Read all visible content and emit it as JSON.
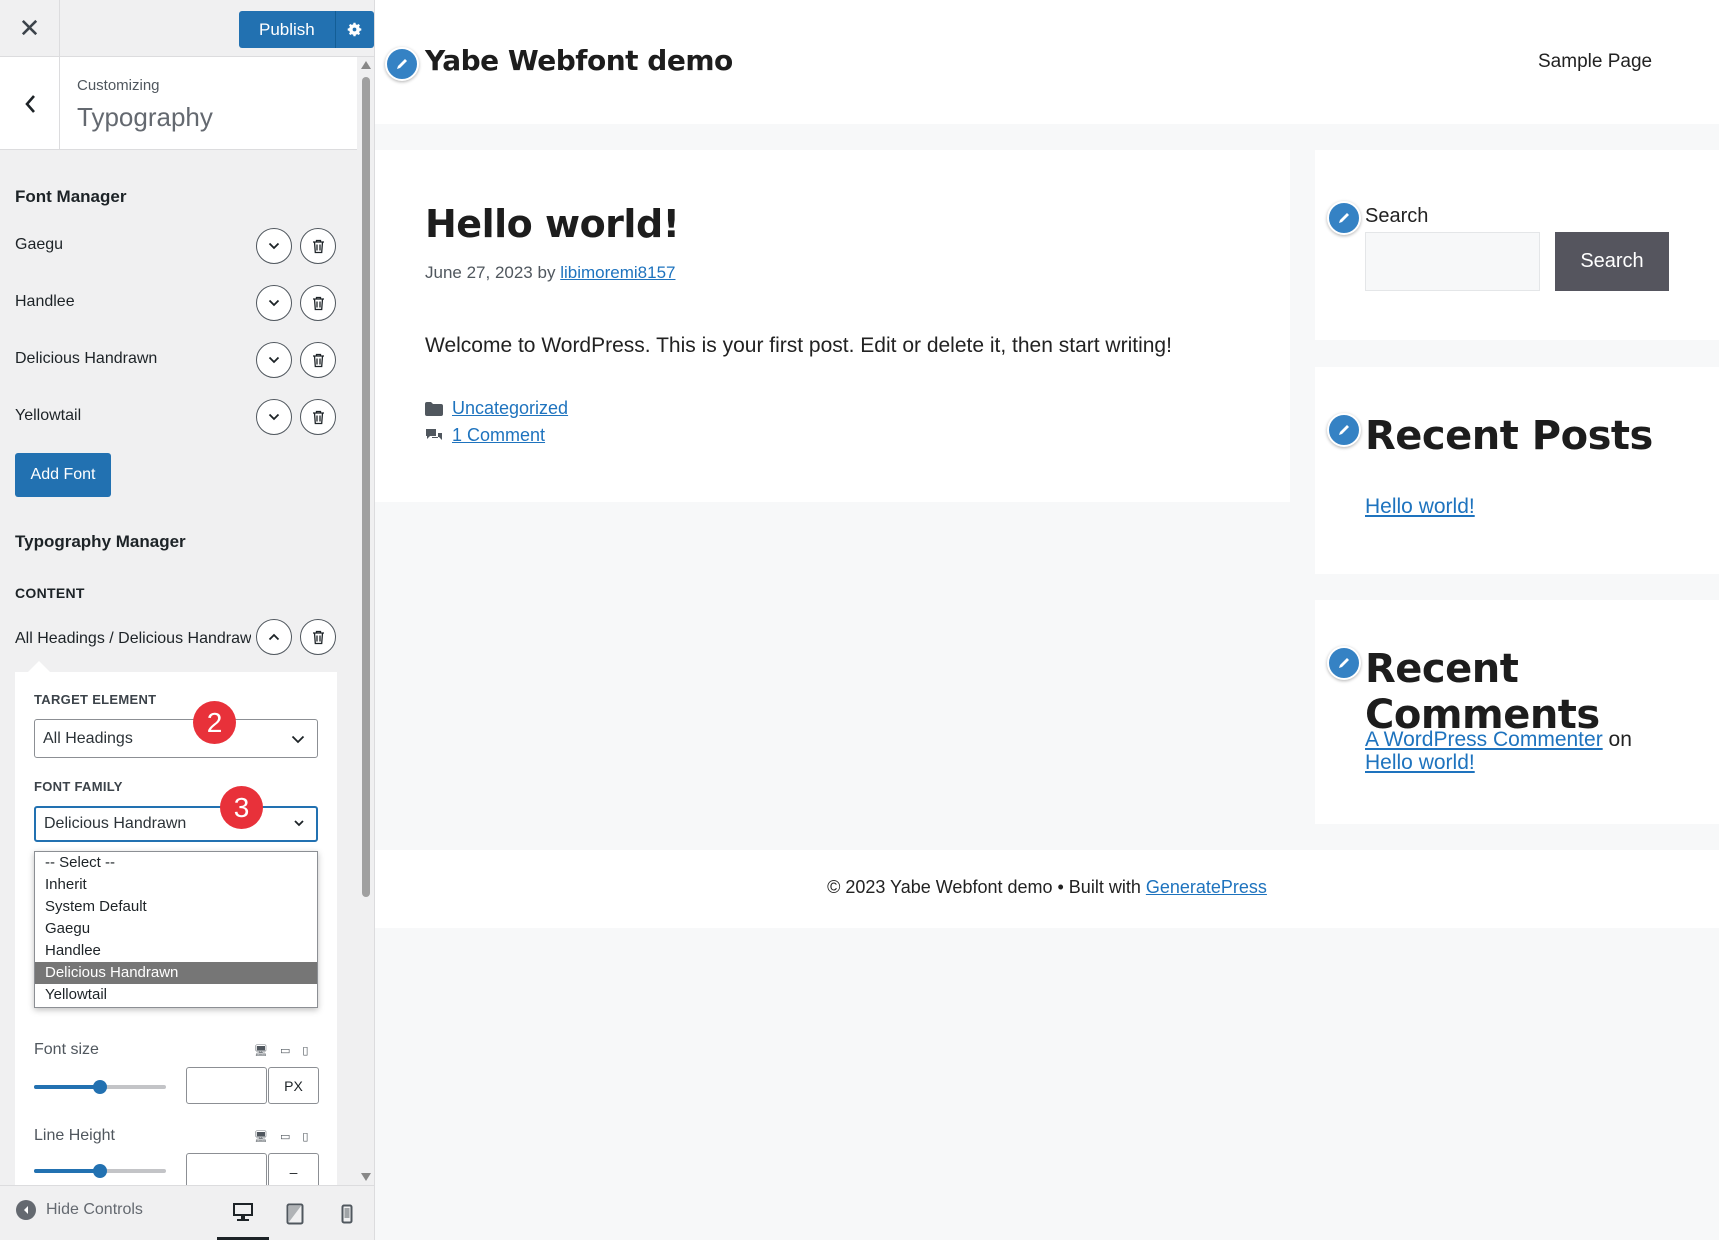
{
  "topbar": {
    "close_glyph": "✕",
    "publish_label": "Publish",
    "settings_icon": "gear-icon"
  },
  "section": {
    "customizing_label": "Customizing",
    "title": "Typography"
  },
  "font_manager": {
    "heading": "Font Manager",
    "fonts": [
      {
        "name": "Gaegu"
      },
      {
        "name": "Handlee"
      },
      {
        "name": "Delicious Handrawn"
      },
      {
        "name": "Yellowtail"
      }
    ],
    "add_font_label": "Add Font"
  },
  "typography_manager": {
    "heading": "Typography Manager",
    "content_label": "CONTENT",
    "row_label": "All Headings / Delicious Handrawn",
    "target_element": {
      "label": "TARGET ELEMENT",
      "value": "All Headings"
    },
    "font_family": {
      "label": "FONT FAMILY",
      "value": "Delicious Handrawn",
      "options": [
        "-- Select --",
        "Inherit",
        "System Default",
        "Gaegu",
        "Handlee",
        "Delicious Handrawn",
        "Yellowtail"
      ],
      "selected_index": 5
    },
    "font_size": {
      "label": "Font size",
      "unit": "PX",
      "slider_fraction": 0.5
    },
    "line_height": {
      "label": "Line Height",
      "unit": "–",
      "slider_fraction": 0.5
    }
  },
  "badges": {
    "step2": "2",
    "step3": "3"
  },
  "footer_bar": {
    "hide_controls": "Hide Controls"
  },
  "preview": {
    "site_title": "Yabe Webfont demo",
    "nav": {
      "sample_page": "Sample Page"
    },
    "post": {
      "title": "Hello world!",
      "date": "June 27, 2023",
      "by": "by",
      "author": "libimoremi8157",
      "body": "Welcome to WordPress. This is your first post. Edit or delete it, then start writing!",
      "category": "Uncategorized",
      "comments": "1 Comment"
    },
    "search_widget": {
      "label": "Search",
      "button": "Search"
    },
    "recent_posts": {
      "title": "Recent Posts",
      "link": "Hello world!"
    },
    "recent_comments": {
      "title": "Recent Comments",
      "author": "A WordPress Commenter",
      "on": "on",
      "post": "Hello world!"
    },
    "footer": {
      "prefix": "© 2023 Yabe Webfont demo • Built with",
      "link": "GeneratePress"
    }
  },
  "colors": {
    "accent": "#2271b1",
    "badge": "#e8313a",
    "link": "#1e73be",
    "edit_bubble": "#3582c4"
  }
}
